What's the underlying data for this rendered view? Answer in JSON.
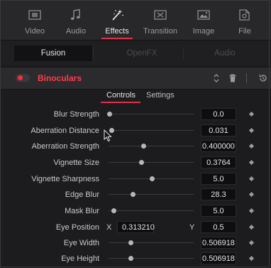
{
  "toolbar": {
    "tabs": [
      {
        "label": "Video",
        "icon": "video-icon"
      },
      {
        "label": "Audio",
        "icon": "music-note-icon"
      },
      {
        "label": "Effects",
        "icon": "magic-wand-icon"
      },
      {
        "label": "Transition",
        "icon": "transition-icon"
      },
      {
        "label": "Image",
        "icon": "image-icon"
      },
      {
        "label": "File",
        "icon": "file-icon"
      }
    ],
    "active_tab": "Effects"
  },
  "subtabs": {
    "items": [
      {
        "label": "Fusion",
        "active": true
      },
      {
        "label": "OpenFX",
        "active": false
      },
      {
        "label": "Audio",
        "active": false
      }
    ]
  },
  "effect": {
    "name": "Binoculars",
    "enabled": true,
    "header_icons": [
      "up-down-arrows-icon",
      "trash-icon",
      "reset-icon"
    ]
  },
  "control_tabs": {
    "controls_label": "Controls",
    "settings_label": "Settings",
    "active": "Controls"
  },
  "params": [
    {
      "label": "Blur Strength",
      "value": "0.0",
      "slider_fraction": 0.0
    },
    {
      "label": "Aberration Distance",
      "value": "0.031",
      "slider_fraction": 0.031
    },
    {
      "label": "Aberration Strength",
      "value": "0.400000",
      "slider_fraction": 0.4
    },
    {
      "label": "Vignette Size",
      "value": "0.3764",
      "slider_fraction": 0.3764
    },
    {
      "label": "Vignette Sharpness",
      "value": "5.0",
      "slider_fraction": 0.5
    },
    {
      "label": "Edge Blur",
      "value": "28.3",
      "slider_fraction": 0.283
    },
    {
      "label": "Mask Blur",
      "value": "5.0",
      "slider_fraction": 0.05
    },
    {
      "label": "Eye Position",
      "x_label": "X",
      "x_value": "0.313210",
      "y_label": "Y",
      "y_value": "0.5"
    },
    {
      "label": "Eye Width",
      "value": "0.506918",
      "slider_fraction": 0.253
    },
    {
      "label": "Eye Height",
      "value": "0.506918",
      "slider_fraction": 0.253
    }
  ],
  "colors": {
    "accent": "#e0304a",
    "effect_name": "#ff3b4c",
    "background": "#1c1c1e"
  }
}
